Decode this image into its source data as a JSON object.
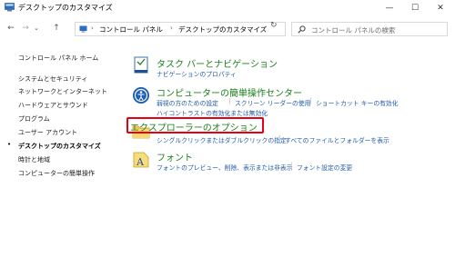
{
  "window": {
    "title": "デスクトップのカスタマイズ",
    "minimize_glyph": "—",
    "maximize_glyph": "☐",
    "close_glyph": "✕"
  },
  "nav": {
    "back_glyph": "←",
    "forward_glyph": "→",
    "dropdown_glyph": "⌄",
    "up_glyph": "↑"
  },
  "address": {
    "breadcrumb": [
      "コントロール パネル",
      "デスクトップのカスタマイズ"
    ],
    "separator": "›",
    "dropdown_glyph": "⌄",
    "refresh_glyph": "↻"
  },
  "search": {
    "placeholder": "コントロール パネルの検索"
  },
  "sidebar": {
    "home": "コントロール パネル ホーム",
    "items": [
      "システムとセキュリティ",
      "ネットワークとインターネット",
      "ハードウェアとサウンド",
      "プログラム",
      "ユーザー アカウント",
      "デスクトップのカスタマイズ",
      "時計と地域",
      "コンピューターの簡単操作"
    ],
    "current_index": 5,
    "bullet": "•"
  },
  "categories": [
    {
      "title": "タスク バーとナビゲーション",
      "icon": "taskbar-icon",
      "links": [
        "ナビゲーションのプロパティ"
      ]
    },
    {
      "title": "コンピューターの簡単操作センター",
      "icon": "ease-of-access-icon",
      "links": [
        "弱視の方のための設定",
        "スクリーン リーダーの使用",
        "ショートカット キーの有効化",
        "ハイコントラストの有効化または無効化"
      ]
    },
    {
      "title": "エクスプローラーのオプション",
      "icon": "folder-options-icon",
      "highlighted": true,
      "links": [
        "シングルクリックまたはダブルクリックの指定",
        "すべてのファイルとフォルダーを表示"
      ]
    },
    {
      "title": "フォント",
      "icon": "fonts-icon",
      "links": [
        "フォントのプレビュー、削除、表示または非表示",
        "フォント設定の変更"
      ]
    }
  ],
  "colors": {
    "category_title": "#1a7f1a",
    "link": "#1f5aab",
    "highlight_border": "#e60012"
  }
}
